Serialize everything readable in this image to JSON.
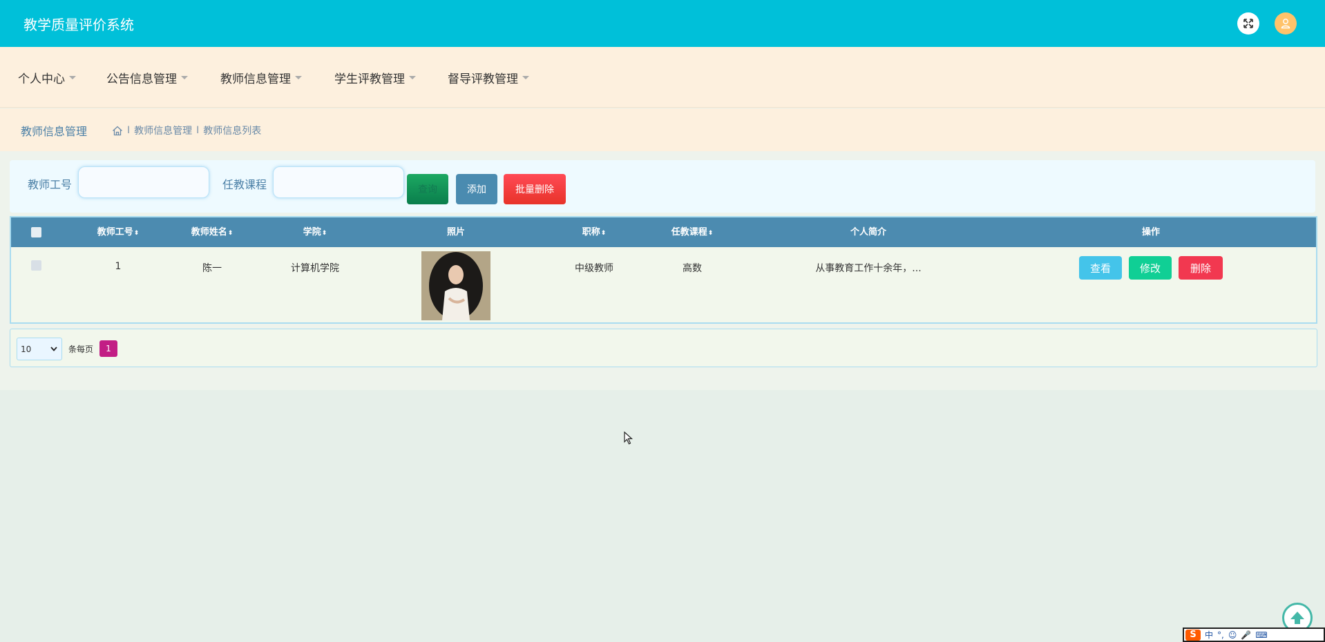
{
  "app": {
    "title": "教学质量评价系统"
  },
  "nav": {
    "items": [
      {
        "label": "个人中心"
      },
      {
        "label": "公告信息管理"
      },
      {
        "label": "教师信息管理"
      },
      {
        "label": "学生评教管理"
      },
      {
        "label": "督导评教管理"
      }
    ]
  },
  "breadcrumb": {
    "title": "教师信息管理",
    "items": [
      "教师信息管理",
      "教师信息列表"
    ],
    "separator": "I"
  },
  "search": {
    "fields": [
      {
        "label": "教师工号",
        "value": "",
        "placeholder": ""
      },
      {
        "label": "任教课程",
        "value": "",
        "placeholder": ""
      }
    ],
    "search_label": "查询",
    "add_label": "添加",
    "batch_delete_label": "批量删除"
  },
  "table": {
    "columns": [
      {
        "label": "教师工号",
        "sortable": true
      },
      {
        "label": "教师姓名",
        "sortable": true
      },
      {
        "label": "学院",
        "sortable": true
      },
      {
        "label": "照片",
        "sortable": false
      },
      {
        "label": "职称",
        "sortable": true
      },
      {
        "label": "任教课程",
        "sortable": true
      },
      {
        "label": "个人简介",
        "sortable": false
      },
      {
        "label": "操作",
        "sortable": false
      }
    ],
    "sort_glyph": "⬍",
    "rows": [
      {
        "id": "1",
        "name": "陈一",
        "college": "计算机学院",
        "title": "中级教师",
        "course": "高数",
        "intro": "从事教育工作十余年，...",
        "actions": {
          "view": "查看",
          "edit": "修改",
          "delete": "删除"
        }
      }
    ]
  },
  "pager": {
    "page_size": "10",
    "per_page_label": "条每页",
    "current_page": "1"
  },
  "colors": {
    "topbar": "#00c0d9",
    "nav_bg": "#fdf0de",
    "table_header": "#4c8bb0",
    "page_accent": "#c21e85"
  },
  "ime": {
    "labels": [
      "中",
      "°,",
      "☺",
      "🎤",
      "⌨"
    ]
  }
}
